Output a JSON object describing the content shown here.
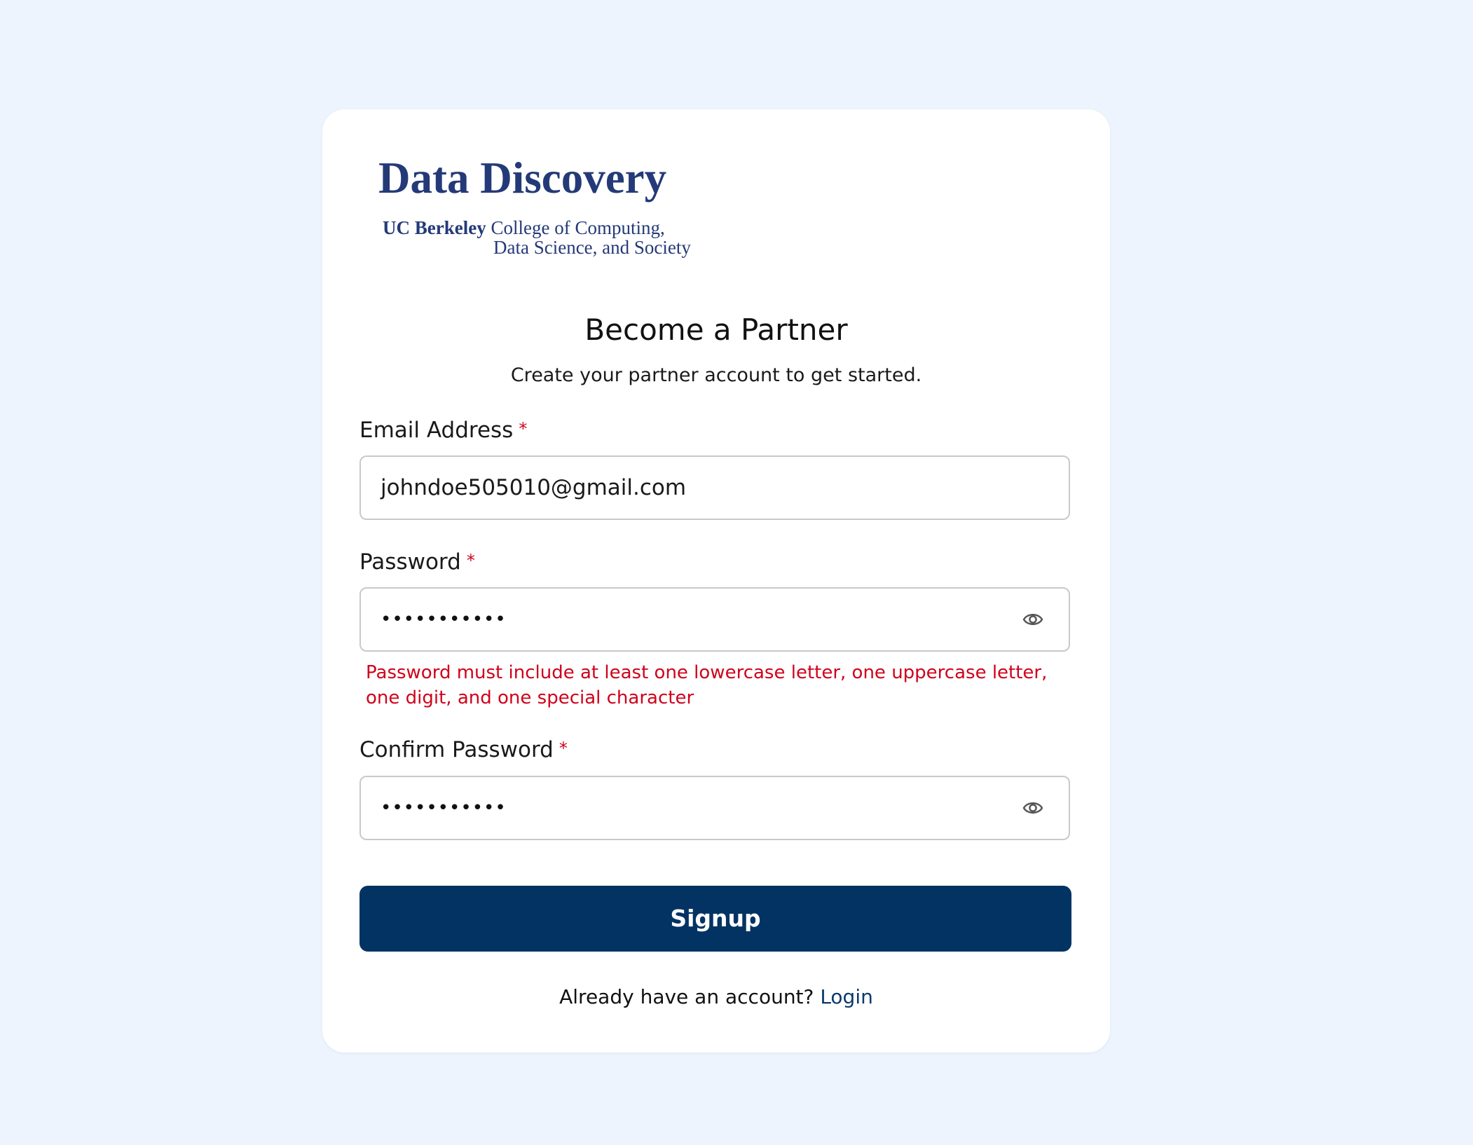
{
  "logo": {
    "title": "Data Discovery",
    "line1_bold": "UC Berkeley",
    "line1_rest": "College of Computing,",
    "line2": "Data Science, and Society"
  },
  "header": {
    "title": "Become a Partner",
    "subtitle": "Create your partner account to get started."
  },
  "form": {
    "email": {
      "label": "Email Address",
      "required_mark": "*",
      "value": "johndoe505010@gmail.com"
    },
    "password": {
      "label": "Password",
      "required_mark": "*",
      "value_masked": "•••••••••••",
      "toggle_icon": "eye-icon",
      "error": "Password must include at least one lowercase letter, one uppercase letter, one digit, and one special character"
    },
    "confirm_password": {
      "label": "Confirm Password",
      "required_mark": "*",
      "value_masked": "•••••••••••",
      "toggle_icon": "eye-icon"
    },
    "submit_label": "Signup"
  },
  "footer": {
    "prompt": "Already have an account?",
    "link": "Login"
  },
  "colors": {
    "background": "#edf4fe",
    "primary": "#033363",
    "error": "#d0021b",
    "logo": "#243a78"
  }
}
